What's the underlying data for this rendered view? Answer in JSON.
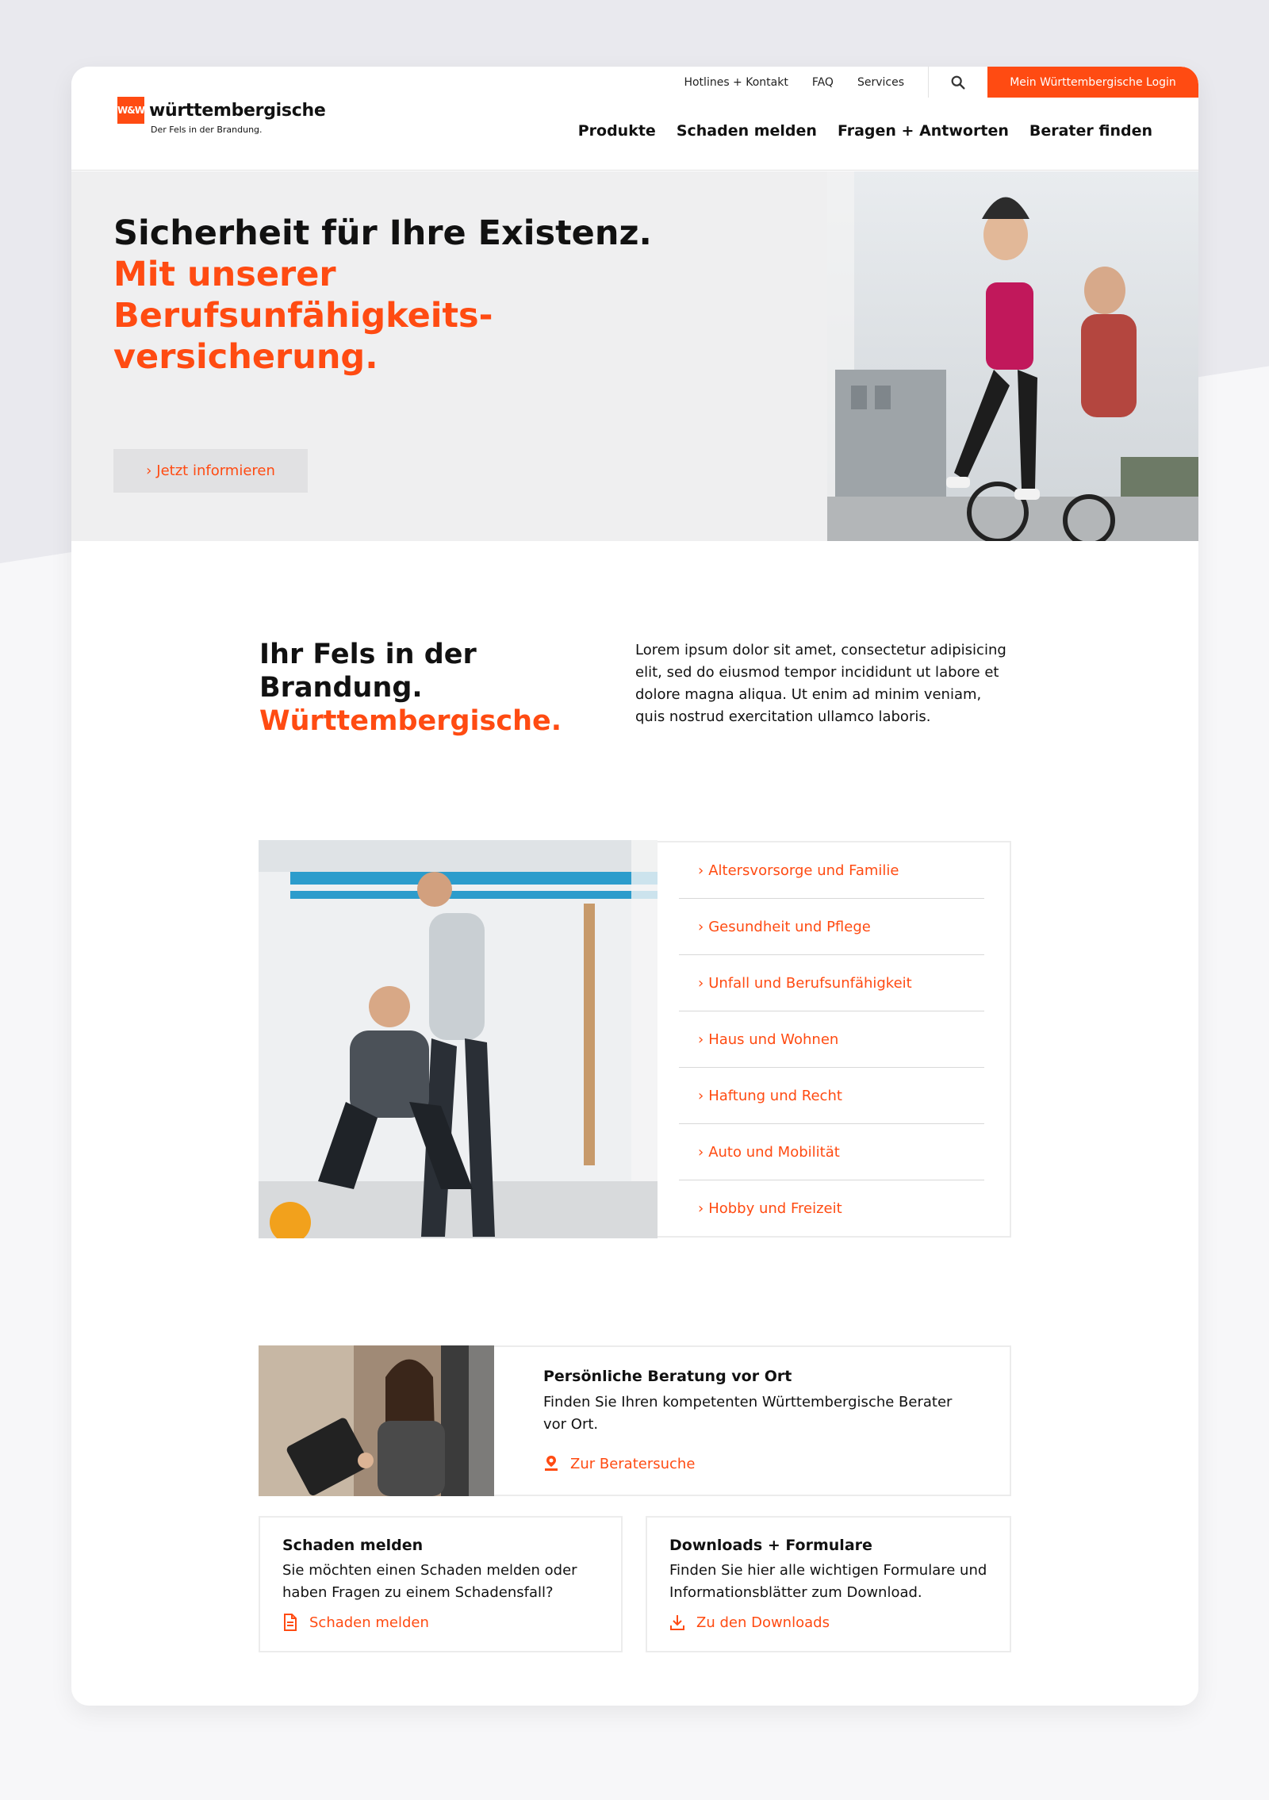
{
  "brand": {
    "mark": "W&W",
    "name": "württembergische",
    "tagline": "Der Fels in der Brandung.",
    "accent_color": "#ff4b12"
  },
  "top_nav": {
    "links": [
      "Hotlines + Kontakt",
      "FAQ",
      "Services"
    ],
    "search_icon": "search-icon",
    "login_label": "Mein Württembergische Login"
  },
  "main_nav": {
    "items": [
      "Produkte",
      "Schaden melden",
      "Fragen + Antworten",
      "Berater finden"
    ]
  },
  "hero": {
    "title_line1": "Sicherheit für Ihre Existenz.",
    "title_line2": "Mit unserer Berufsunfähigkeits-",
    "title_line3": "versicherung.",
    "button_label": "Jetzt informieren"
  },
  "intro": {
    "title_line1": "Ihr Fels in der",
    "title_line2": "Brandung.",
    "title_line3": "Württembergische.",
    "text": "Lorem ipsum dolor sit amet, consectetur adipisicing elit, sed do eiusmod tempor incididunt ut labore et dolore magna aliqua. Ut enim ad minim veniam, quis nostrud exercitation ullamco laboris."
  },
  "products": {
    "items": [
      "Altersvorsorge und Familie",
      "Gesundheit und Pflege",
      "Unfall und Berufsunfähigkeit",
      "Haus und Wohnen",
      "Haftung und Recht",
      "Auto und Mobilität",
      "Hobby und Freizeit"
    ]
  },
  "advisor": {
    "title": "Persönliche Beratung vor Ort",
    "text": "Finden Sie Ihren kompetenten Württembergische Berater vor Ort.",
    "link": "Zur Beratersuche",
    "icon": "location-person-icon"
  },
  "claims": {
    "title": "Schaden melden",
    "text": "Sie möchten einen Schaden melden oder haben Fragen zu einem Schadensfall?",
    "link": "Schaden melden",
    "icon": "document-icon"
  },
  "downloads": {
    "title": "Downloads + Formulare",
    "text": "Finden Sie hier alle wichtigen Formulare und Informationsblätter zum Download.",
    "link": "Zu den Downloads",
    "icon": "download-icon"
  }
}
